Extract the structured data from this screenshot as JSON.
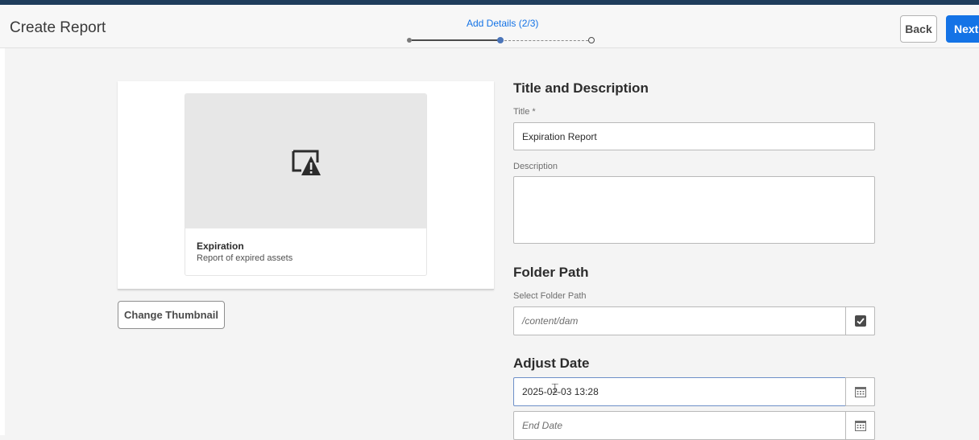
{
  "header": {
    "title": "Create Report",
    "step_label": "Add Details (2/3)",
    "back_label": "Back",
    "next_label": "Next"
  },
  "wizard": {
    "current_step": 2,
    "total_steps": 3
  },
  "report_card": {
    "title": "Expiration",
    "description": "Report of expired assets",
    "thumbnail_icon": "image-missing-warning-icon"
  },
  "change_thumbnail_label": "Change Thumbnail",
  "title_section": {
    "heading": "Title and Description",
    "title_label": "Title *",
    "title_value": "Expiration Report",
    "description_label": "Description",
    "description_value": ""
  },
  "folder_section": {
    "heading": "Folder Path",
    "label": "Select Folder Path",
    "placeholder": "/content/dam",
    "picker_icon": "check-icon"
  },
  "date_section": {
    "heading": "Adjust Date",
    "start_value": "2025-02-03 13:28",
    "end_placeholder": "End Date",
    "calendar_icon": "calendar-icon"
  },
  "colors": {
    "accent": "#1473e6",
    "topbar": "#1f3d5c"
  }
}
